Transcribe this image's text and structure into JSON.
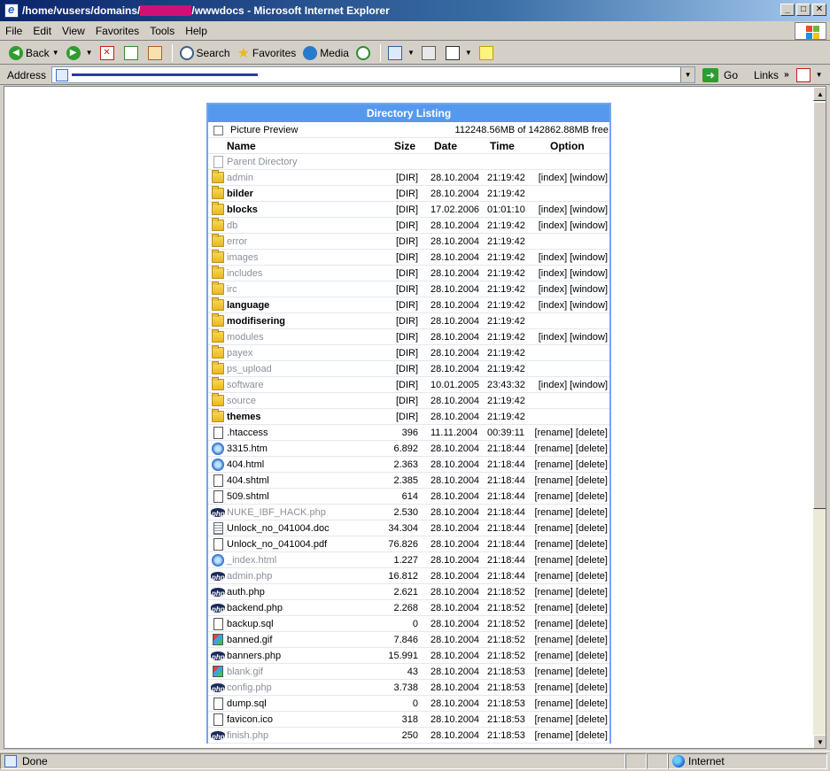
{
  "window": {
    "title_prefix": "/home/vusers/domains/",
    "title_suffix": "/wwwdocs - Microsoft Internet Explorer",
    "minimize": "_",
    "maximize": "□",
    "close": "✕"
  },
  "menu": [
    "File",
    "Edit",
    "View",
    "Favorites",
    "Tools",
    "Help"
  ],
  "toolbar": {
    "back": "Back",
    "search": "Search",
    "favorites": "Favorites",
    "media": "Media"
  },
  "address": {
    "label": "Address",
    "go": "Go",
    "links": "Links"
  },
  "listing": {
    "title": "Directory Listing",
    "preview_label": "Picture Preview",
    "free_space": "112248.56MB of 142862.88MB free",
    "headers": {
      "name": "Name",
      "size": "Size",
      "date": "Date",
      "time": "Time",
      "option": "Option"
    },
    "parent": "Parent Directory",
    "rows": [
      {
        "name": "admin",
        "size": "[DIR]",
        "date": "28.10.2004",
        "time": "21:19:42",
        "opt": "[index] [window]",
        "icon": "folder",
        "style": "grey"
      },
      {
        "name": "bilder",
        "size": "[DIR]",
        "date": "28.10.2004",
        "time": "21:19:42",
        "opt": "",
        "icon": "folder",
        "style": "bold"
      },
      {
        "name": "blocks",
        "size": "[DIR]",
        "date": "17.02.2006",
        "time": "01:01:10",
        "opt": "[index] [window]",
        "icon": "folder",
        "style": "bold"
      },
      {
        "name": "db",
        "size": "[DIR]",
        "date": "28.10.2004",
        "time": "21:19:42",
        "opt": "[index] [window]",
        "icon": "folder",
        "style": "grey"
      },
      {
        "name": "error",
        "size": "[DIR]",
        "date": "28.10.2004",
        "time": "21:19:42",
        "opt": "",
        "icon": "folder",
        "style": "grey"
      },
      {
        "name": "images",
        "size": "[DIR]",
        "date": "28.10.2004",
        "time": "21:19:42",
        "opt": "[index] [window]",
        "icon": "folder",
        "style": "grey"
      },
      {
        "name": "includes",
        "size": "[DIR]",
        "date": "28.10.2004",
        "time": "21:19:42",
        "opt": "[index] [window]",
        "icon": "folder",
        "style": "grey"
      },
      {
        "name": "irc",
        "size": "[DIR]",
        "date": "28.10.2004",
        "time": "21:19:42",
        "opt": "[index] [window]",
        "icon": "folder",
        "style": "grey"
      },
      {
        "name": "language",
        "size": "[DIR]",
        "date": "28.10.2004",
        "time": "21:19:42",
        "opt": "[index] [window]",
        "icon": "folder",
        "style": "bold"
      },
      {
        "name": "modifisering",
        "size": "[DIR]",
        "date": "28.10.2004",
        "time": "21:19:42",
        "opt": "",
        "icon": "folder",
        "style": "bold"
      },
      {
        "name": "modules",
        "size": "[DIR]",
        "date": "28.10.2004",
        "time": "21:19:42",
        "opt": "[index] [window]",
        "icon": "folder",
        "style": "grey"
      },
      {
        "name": "payex",
        "size": "[DIR]",
        "date": "28.10.2004",
        "time": "21:19:42",
        "opt": "",
        "icon": "folder",
        "style": "grey"
      },
      {
        "name": "ps_upload",
        "size": "[DIR]",
        "date": "28.10.2004",
        "time": "21:19:42",
        "opt": "",
        "icon": "folder",
        "style": "grey"
      },
      {
        "name": "software",
        "size": "[DIR]",
        "date": "10.01.2005",
        "time": "23:43:32",
        "opt": "[index] [window]",
        "icon": "folder",
        "style": "grey"
      },
      {
        "name": "source",
        "size": "[DIR]",
        "date": "28.10.2004",
        "time": "21:19:42",
        "opt": "",
        "icon": "folder",
        "style": "grey"
      },
      {
        "name": "themes",
        "size": "[DIR]",
        "date": "28.10.2004",
        "time": "21:19:42",
        "opt": "",
        "icon": "folder",
        "style": "bold"
      },
      {
        "name": ".htaccess",
        "size": "396",
        "date": "11.11.2004",
        "time": "00:39:11",
        "opt": "[rename] [delete]",
        "icon": "file",
        "style": ""
      },
      {
        "name": "3315.htm",
        "size": "6.892",
        "date": "28.10.2004",
        "time": "21:18:44",
        "opt": "[rename] [delete]",
        "icon": "html",
        "style": ""
      },
      {
        "name": "404.html",
        "size": "2.363",
        "date": "28.10.2004",
        "time": "21:18:44",
        "opt": "[rename] [delete]",
        "icon": "html",
        "style": ""
      },
      {
        "name": "404.shtml",
        "size": "2.385",
        "date": "28.10.2004",
        "time": "21:18:44",
        "opt": "[rename] [delete]",
        "icon": "file",
        "style": ""
      },
      {
        "name": "509.shtml",
        "size": "614",
        "date": "28.10.2004",
        "time": "21:18:44",
        "opt": "[rename] [delete]",
        "icon": "file",
        "style": ""
      },
      {
        "name": "NUKE_IBF_HACK.php",
        "size": "2.530",
        "date": "28.10.2004",
        "time": "21:18:44",
        "opt": "[rename] [delete]",
        "icon": "php",
        "style": "grey"
      },
      {
        "name": "Unlock_no_041004.doc",
        "size": "34.304",
        "date": "28.10.2004",
        "time": "21:18:44",
        "opt": "[rename] [delete]",
        "icon": "doc",
        "style": ""
      },
      {
        "name": "Unlock_no_041004.pdf",
        "size": "76.826",
        "date": "28.10.2004",
        "time": "21:18:44",
        "opt": "[rename] [delete]",
        "icon": "file",
        "style": ""
      },
      {
        "name": "_index.html",
        "size": "1.227",
        "date": "28.10.2004",
        "time": "21:18:44",
        "opt": "[rename] [delete]",
        "icon": "html",
        "style": "grey"
      },
      {
        "name": "admin.php",
        "size": "16.812",
        "date": "28.10.2004",
        "time": "21:18:44",
        "opt": "[rename] [delete]",
        "icon": "php",
        "style": "grey"
      },
      {
        "name": "auth.php",
        "size": "2.621",
        "date": "28.10.2004",
        "time": "21:18:52",
        "opt": "[rename] [delete]",
        "icon": "php",
        "style": ""
      },
      {
        "name": "backend.php",
        "size": "2.268",
        "date": "28.10.2004",
        "time": "21:18:52",
        "opt": "[rename] [delete]",
        "icon": "php",
        "style": ""
      },
      {
        "name": "backup.sql",
        "size": "0",
        "date": "28.10.2004",
        "time": "21:18:52",
        "opt": "[rename] [delete]",
        "icon": "file",
        "style": ""
      },
      {
        "name": "banned.gif",
        "size": "7.846",
        "date": "28.10.2004",
        "time": "21:18:52",
        "opt": "[rename] [delete]",
        "icon": "gif",
        "style": ""
      },
      {
        "name": "banners.php",
        "size": "15.991",
        "date": "28.10.2004",
        "time": "21:18:52",
        "opt": "[rename] [delete]",
        "icon": "php",
        "style": ""
      },
      {
        "name": "blank.gif",
        "size": "43",
        "date": "28.10.2004",
        "time": "21:18:53",
        "opt": "[rename] [delete]",
        "icon": "gif",
        "style": "grey"
      },
      {
        "name": "config.php",
        "size": "3.738",
        "date": "28.10.2004",
        "time": "21:18:53",
        "opt": "[rename] [delete]",
        "icon": "php",
        "style": "grey"
      },
      {
        "name": "dump.sql",
        "size": "0",
        "date": "28.10.2004",
        "time": "21:18:53",
        "opt": "[rename] [delete]",
        "icon": "file",
        "style": ""
      },
      {
        "name": "favicon.ico",
        "size": "318",
        "date": "28.10.2004",
        "time": "21:18:53",
        "opt": "[rename] [delete]",
        "icon": "file",
        "style": ""
      },
      {
        "name": "finish.php",
        "size": "250",
        "date": "28.10.2004",
        "time": "21:18:53",
        "opt": "[rename] [delete]",
        "icon": "php",
        "style": "grey"
      }
    ]
  },
  "status": {
    "text": "Done",
    "zone": "Internet"
  }
}
